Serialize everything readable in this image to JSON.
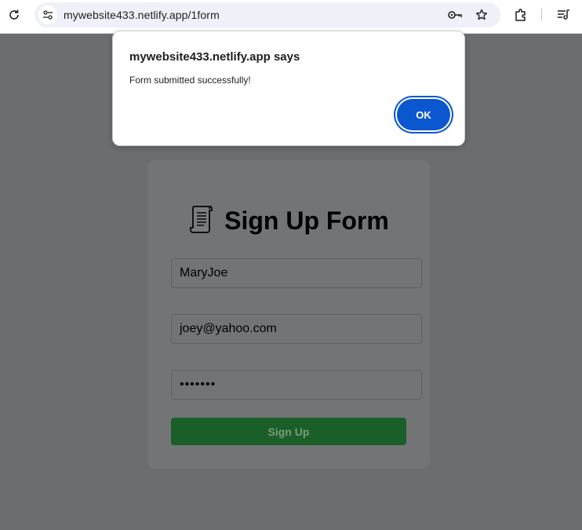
{
  "browser": {
    "url": "mywebsite433.netlify.app/1form"
  },
  "dialog": {
    "title": "mywebsite433.netlify.app says",
    "message": "Form submitted successfully!",
    "ok_label": "OK"
  },
  "form": {
    "heading": "Sign Up Form",
    "username_value": "MaryJoe",
    "email_value": "joey@yahoo.com",
    "password_value": "•••••••",
    "submit_label": "Sign Up"
  },
  "colors": {
    "overlay_bg": "#6b6d70",
    "dialog_button": "#0b57d0",
    "submit_button": "#1b5f28"
  },
  "icons": [
    "reload-icon",
    "site-settings-icon",
    "password-key-icon",
    "bookmark-star-icon",
    "extensions-icon",
    "reading-list-icon",
    "scroll-icon"
  ]
}
